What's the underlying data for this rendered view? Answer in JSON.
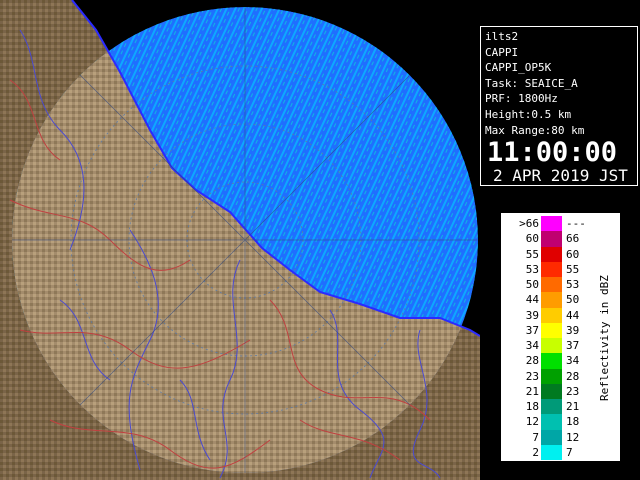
{
  "info": {
    "radar_name": "ilts2",
    "product": "CAPPI",
    "product_id": "CAPPI_OP5K",
    "task": "Task: SEAICE_A",
    "prf": "PRF: 1800Hz",
    "height": "Height:0.5 km",
    "max_range": "Max Range:80 km",
    "time": "11:00:00",
    "date": "2 APR 2019 JST"
  },
  "legend": {
    "title": "Reflectivity in dBZ",
    "rows": [
      {
        "lo": ">66",
        "hi": "---",
        "color": "#ff00ff"
      },
      {
        "lo": "60",
        "hi": "66",
        "color": "#c00070"
      },
      {
        "lo": "55",
        "hi": "60",
        "color": "#e00000"
      },
      {
        "lo": "53",
        "hi": "55",
        "color": "#ff2a00"
      },
      {
        "lo": "50",
        "hi": "53",
        "color": "#ff6a00"
      },
      {
        "lo": "44",
        "hi": "50",
        "color": "#ff9c00"
      },
      {
        "lo": "39",
        "hi": "44",
        "color": "#ffcc00"
      },
      {
        "lo": "37",
        "hi": "39",
        "color": "#ffff00"
      },
      {
        "lo": "34",
        "hi": "37",
        "color": "#c8ff00"
      },
      {
        "lo": "28",
        "hi": "34",
        "color": "#00e000"
      },
      {
        "lo": "23",
        "hi": "28",
        "color": "#00a000"
      },
      {
        "lo": "21",
        "hi": "23",
        "color": "#007a20"
      },
      {
        "lo": "18",
        "hi": "21",
        "color": "#009a78"
      },
      {
        "lo": "12",
        "hi": "18",
        "color": "#00c0b0"
      },
      {
        "lo": "7",
        "hi": "12",
        "color": "#00a6a6"
      },
      {
        "lo": "2",
        "hi": "7",
        "color": "#00f0f0"
      }
    ]
  },
  "map": {
    "land_color": "#7a6448",
    "land_in_range_color": "#a48c6c",
    "sea_in_range_color": "#1f6fff",
    "coastline_color": "#3030ff",
    "river_color": "#4a4ad0",
    "boundary_color": "#c04040"
  }
}
